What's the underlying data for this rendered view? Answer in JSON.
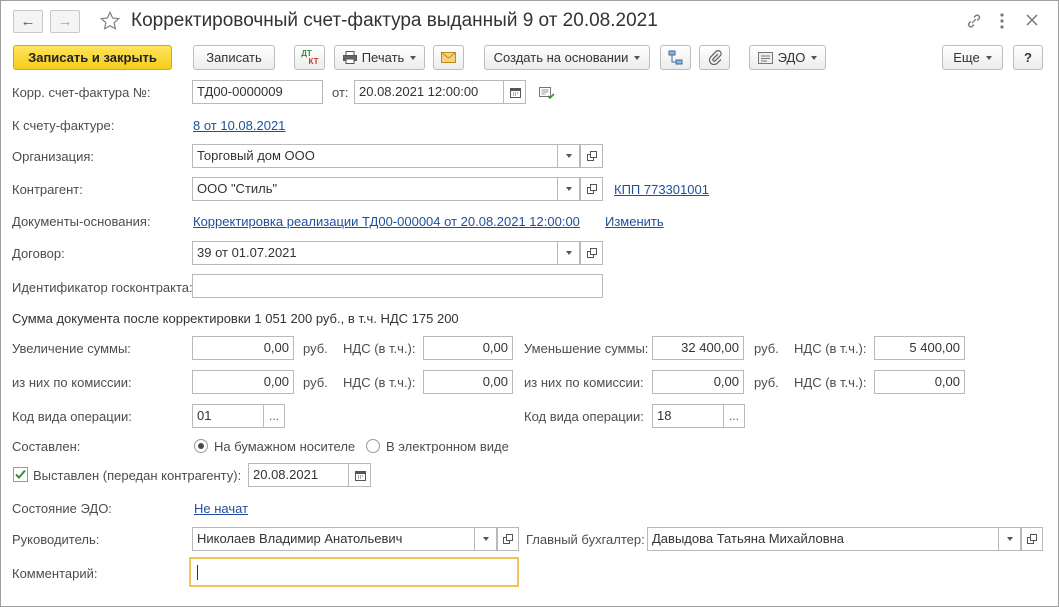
{
  "window": {
    "title": "Корректировочный счет-фактура выданный 9 от 20.08.2021"
  },
  "toolbar": {
    "save_close": "Записать и закрыть",
    "save": "Записать",
    "dtkt_top": "ДТ",
    "dtkt_bottom": "КТ",
    "print": "Печать",
    "create_based": "Создать на основании",
    "edo": "ЭДО",
    "more": "Еще",
    "help": "?"
  },
  "form": {
    "corr_invoice_label": "Корр. счет-фактура №:",
    "corr_invoice_number": "ТД00-0000009",
    "from_label": "от:",
    "corr_invoice_date": "20.08.2021 12:00:00",
    "to_invoice_label": "К счету-фактуре:",
    "to_invoice_link": "8 от 10.08.2021",
    "organization_label": "Организация:",
    "organization_value": "Торговый дом ООО",
    "counterparty_label": "Контрагент:",
    "counterparty_value": "ООО \"Стиль\"",
    "kpp_link": "КПП 773301001",
    "base_docs_label": "Документы-основания:",
    "base_docs_link": "Корректировка реализации ТД00-000004 от 20.08.2021 12:00:00",
    "change_link": "Изменить",
    "contract_label": "Договор:",
    "contract_value": "39 от 01.07.2021",
    "gov_id_label": "Идентификатор госконтракта:",
    "gov_id_value": "",
    "sum_after_text": "Сумма документа после корректировки 1 051 200 руб., в т.ч. НДС 175 200",
    "increase_label": "Увеличение суммы:",
    "increase_value": "0,00",
    "rub": "руб.",
    "vat_label": "НДС (в т.ч.):",
    "increase_vat": "0,00",
    "decrease_label": "Уменьшение суммы:",
    "decrease_value": "32 400,00",
    "decrease_vat": "5 400,00",
    "commission_label": "из них по комиссии:",
    "inc_commission_value": "0,00",
    "inc_commission_vat": "0,00",
    "dec_commission_value": "0,00",
    "dec_commission_vat": "0,00",
    "op_code_label": "Код вида операции:",
    "op_code_left": "01",
    "op_code_right": "18",
    "ellipsis": "...",
    "composed_label": "Составлен:",
    "paper_option": "На бумажном носителе",
    "electronic_option": "В электронном виде",
    "issued_label": "Выставлен (передан контрагенту):",
    "issued_date": "20.08.2021",
    "edo_state_label": "Состояние ЭДО:",
    "edo_state_link": "Не начат",
    "head_label": "Руководитель:",
    "head_value": "Николаев Владимир Анатольевич",
    "chief_acc_label": "Главный бухгалтер:",
    "chief_acc_value": "Давыдова Татьяна Михайловна",
    "comment_label": "Комментарий:",
    "comment_value": ""
  },
  "colors": {
    "primary_button": "#f5cd1a",
    "link": "#1f4e9e",
    "focus": "#f2c45a",
    "check": "#3a8c3a"
  }
}
